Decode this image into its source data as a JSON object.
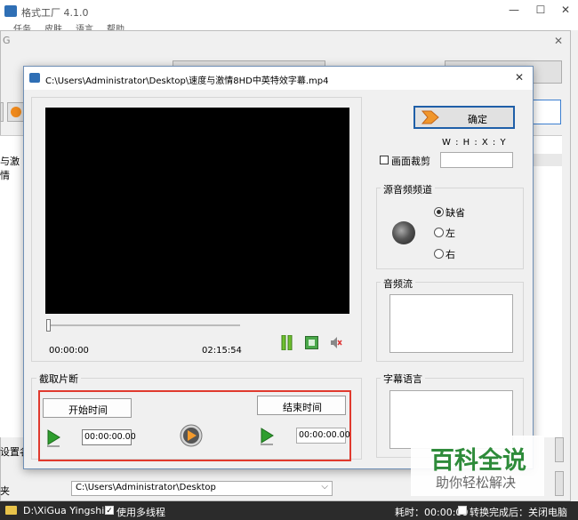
{
  "main_window": {
    "title": "格式工厂 4.1.0",
    "menu": [
      "任务",
      "皮肤",
      "语言",
      "帮助"
    ],
    "file_label": "与激情",
    "settings_label": "设置名",
    "folder_label": "夹",
    "output_path": "C:\\Users\\Administrator\\Desktop"
  },
  "taskbar": {
    "left_text": "D:\\XiGua Yingshi",
    "multithread_label": "使用多线程",
    "elapsed_label": "耗时：00:00:00",
    "after_convert_label": "转换完成后：关闭电脑"
  },
  "dialog": {
    "title": "C:\\Users\\Administrator\\Desktop\\速度与激情8HD中英特效字幕.mp4",
    "confirm_label": "确定",
    "crop_coords": "W : H : X : Y",
    "crop_label": "画面裁剪",
    "crop_value": "",
    "audio_channel_title": "源音频频道",
    "audio_options": [
      "缺省",
      "左",
      "右"
    ],
    "audio_selected_index": 0,
    "audio_stream_title": "音频流",
    "subtitle_title": "字幕语言",
    "time_current": "00:00:00",
    "time_total": "02:15:54",
    "slider_position": 0,
    "clip_title": "截取片断",
    "start_label": "开始时间",
    "end_label": "结束时间",
    "start_value": "00:00:00.00",
    "end_value": "00:00:00.00"
  },
  "watermark": {
    "title": "百科全说",
    "subtitle": "助你轻松解决"
  },
  "colors": {
    "highlight_red": "#e03a2e",
    "watermark_green": "#2e8b3a",
    "confirm_border": "#1f5fa8",
    "play_green": "#2e9e2e"
  }
}
